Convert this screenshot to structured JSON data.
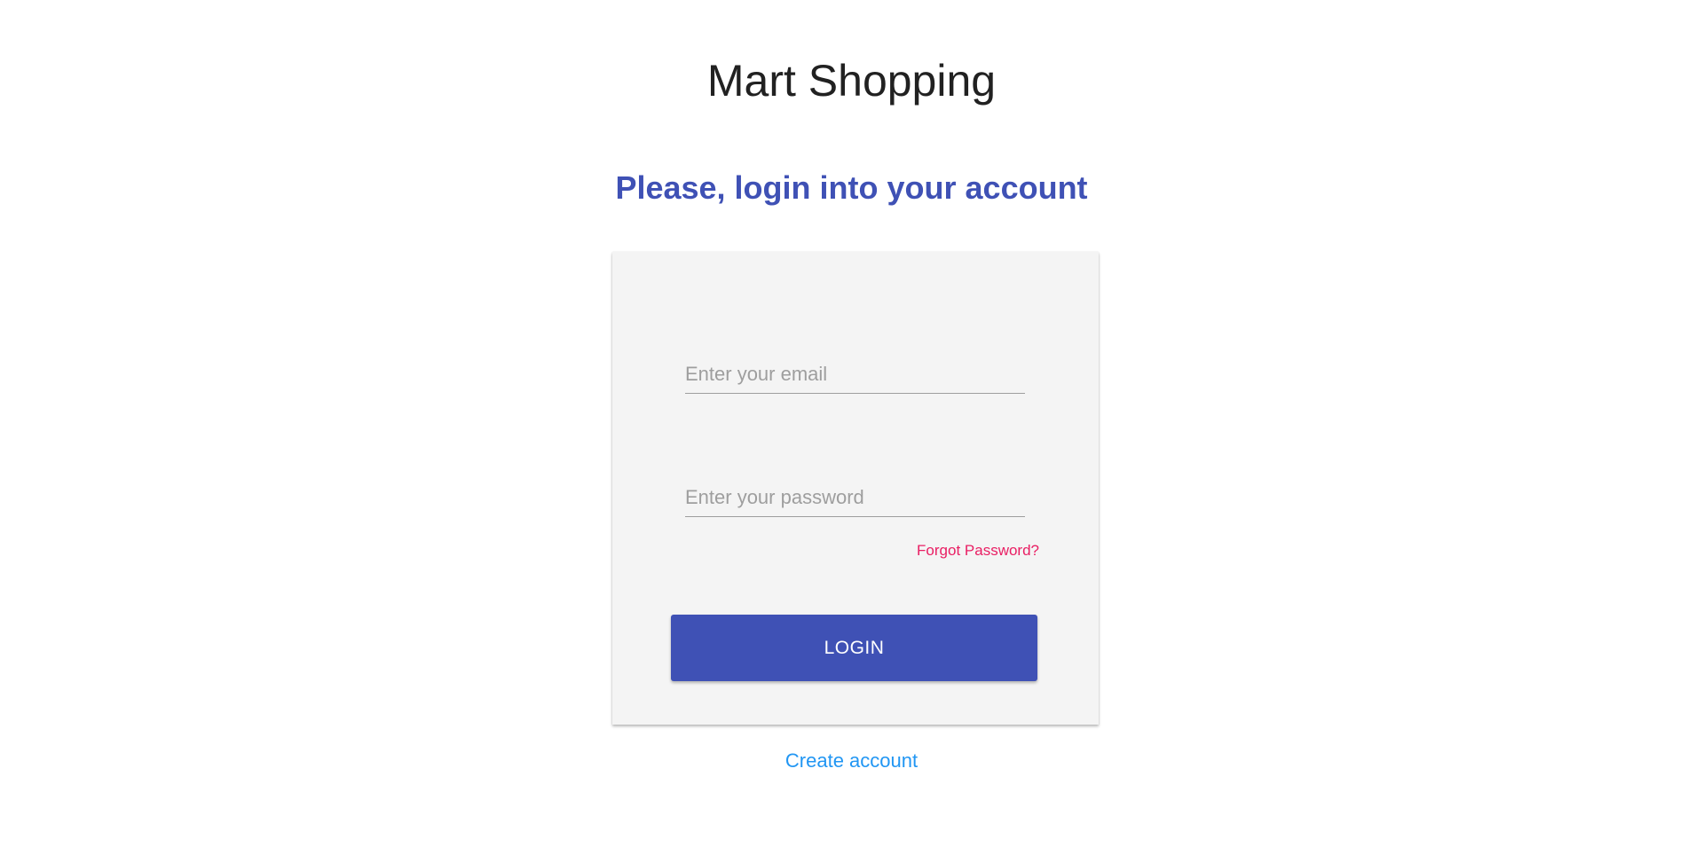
{
  "header": {
    "app_title": "Mart Shopping",
    "subtitle": "Please, login into your account"
  },
  "login_form": {
    "email": {
      "value": "",
      "placeholder": "Enter your email"
    },
    "password": {
      "value": "",
      "placeholder": "Enter your password"
    },
    "forgot_password_label": "Forgot Password?",
    "login_button_label": "LOGIN"
  },
  "footer": {
    "create_account_label": "Create account"
  },
  "colors": {
    "primary": "#3f51b5",
    "accent": "#e91e63",
    "link": "#2196f3",
    "card_background": "#f4f4f4",
    "title_text": "#212121"
  }
}
